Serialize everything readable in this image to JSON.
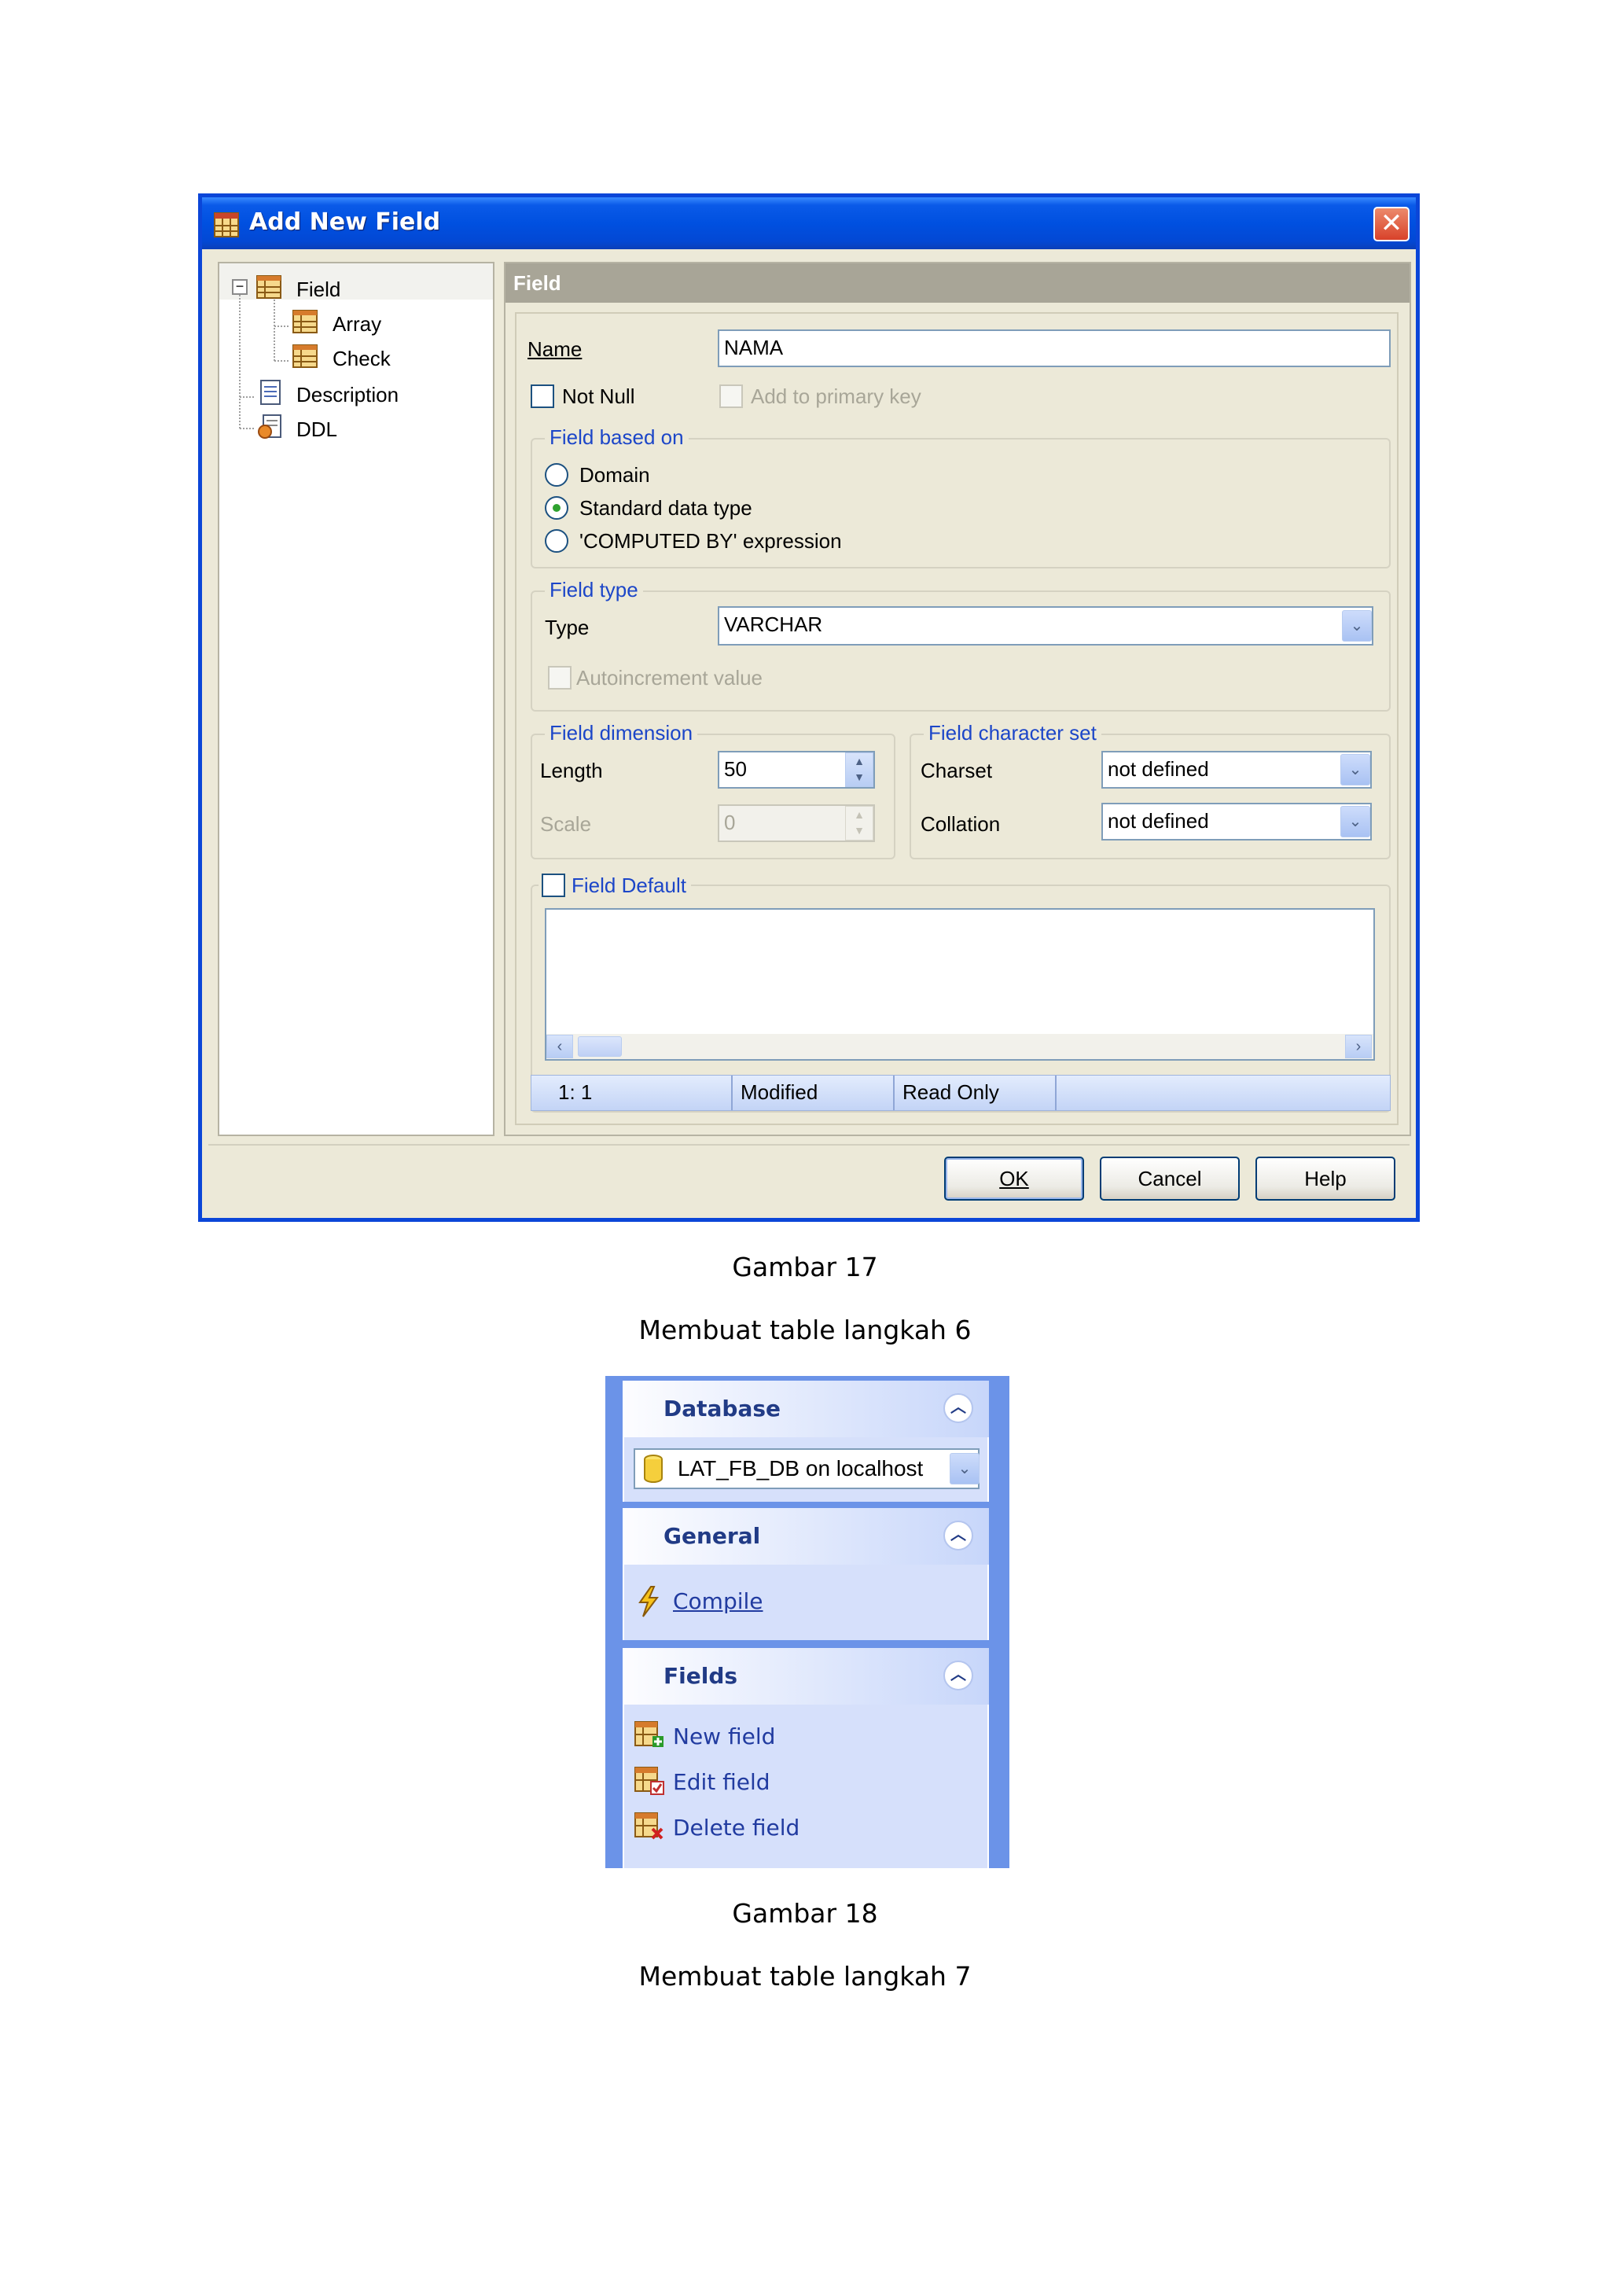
{
  "figure17": {
    "window_title": "Add New Field",
    "tree": [
      {
        "label": "Field",
        "level": 0
      },
      {
        "label": "Array",
        "level": 1
      },
      {
        "label": "Check",
        "level": 1
      },
      {
        "label": "Description",
        "level": 0
      },
      {
        "label": "DDL",
        "level": 0
      }
    ],
    "panel_title": "Field",
    "name_label": "Name",
    "name_value": "NAMA",
    "not_null_label": "Not Null",
    "add_primary_key_label": "Add to primary key",
    "based_on": {
      "title": "Field based on",
      "options": [
        "Domain",
        "Standard data type",
        "'COMPUTED BY' expression"
      ],
      "selected": "Standard data type"
    },
    "field_type": {
      "title": "Field type",
      "type_label": "Type",
      "type_value": "VARCHAR",
      "autoincrement_label": "Autoincrement value"
    },
    "dimension": {
      "title": "Field dimension",
      "length_label": "Length",
      "length_value": "50",
      "scale_label": "Scale",
      "scale_value": "0"
    },
    "charset_group": {
      "title": "Field character set",
      "charset_label": "Charset",
      "charset_value": "not defined",
      "collation_label": "Collation",
      "collation_value": "not defined"
    },
    "default_label": "Field Default",
    "status": {
      "position": "1:  1",
      "modified": "Modified",
      "read_only": "Read Only"
    },
    "buttons": {
      "ok": "OK",
      "cancel": "Cancel",
      "help": "Help"
    },
    "caption_title": "Gambar 17",
    "caption_text": "Membuat table langkah 6"
  },
  "figure18": {
    "database_header": "Database",
    "database_value": "LAT_FB_DB on localhost",
    "general_header": "General",
    "compile_label": "Compile",
    "fields_header": "Fields",
    "new_field": "New field",
    "edit_field": "Edit field",
    "delete_field": "Delete field",
    "caption_title": "Gambar 18",
    "caption_text": "Membuat table langkah 7"
  },
  "colors": {
    "titlebar": "#0050e0",
    "dialog_bg": "#ece9d8",
    "group_title": "#1c46c8",
    "taskpane_bg": "#6b93e8"
  }
}
